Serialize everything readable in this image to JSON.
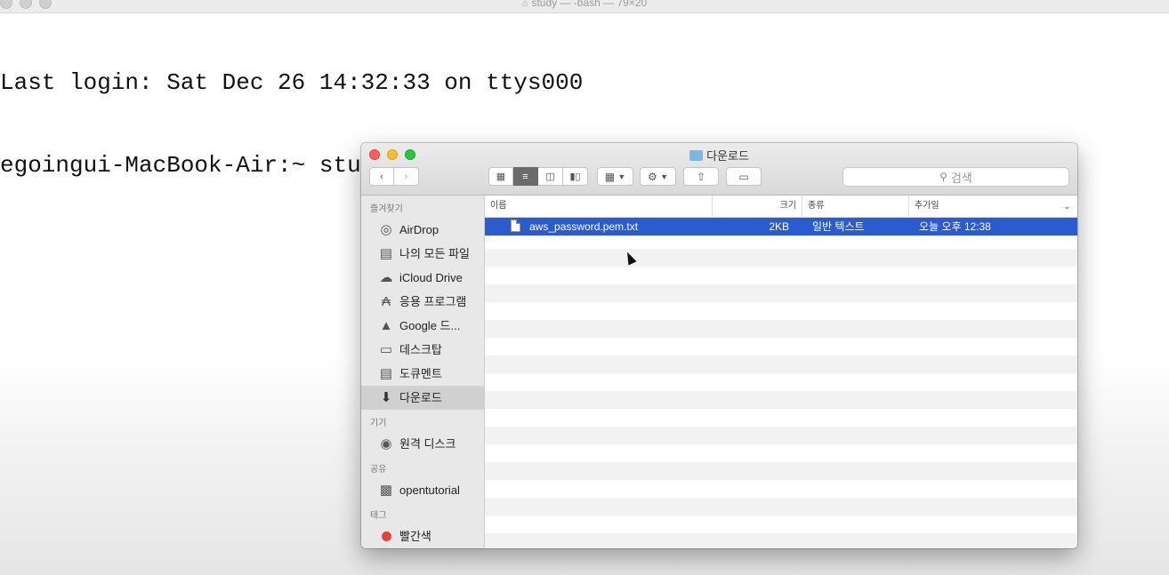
{
  "terminal": {
    "title": "study — -bash — 79×20",
    "lines": [
      "Last login: Sat Dec 26 14:32:33 on ttys000",
      "egoingui-MacBook-Air:~ study$ "
    ]
  },
  "finder": {
    "title": "다운로드",
    "search_placeholder": "검색",
    "sidebar": {
      "favorites_header": "즐겨찾기",
      "favorites": [
        {
          "label": "AirDrop",
          "icon": "airdrop-icon"
        },
        {
          "label": "나의 모든 파일",
          "icon": "all-files-icon"
        },
        {
          "label": "iCloud Drive",
          "icon": "cloud-icon"
        },
        {
          "label": "응용 프로그램",
          "icon": "applications-icon"
        },
        {
          "label": "Google 드...",
          "icon": "google-drive-icon"
        },
        {
          "label": "데스크탑",
          "icon": "desktop-icon"
        },
        {
          "label": "도큐멘트",
          "icon": "documents-icon"
        },
        {
          "label": "다운로드",
          "icon": "downloads-icon"
        }
      ],
      "devices_header": "기기",
      "devices": [
        {
          "label": "원격 디스크",
          "icon": "disc-icon"
        }
      ],
      "shared_header": "공유",
      "shared": [
        {
          "label": "opentutorial",
          "icon": "computer-icon"
        }
      ],
      "tags_header": "태그",
      "tags": [
        {
          "label": "빨간색",
          "color": "#e4433b"
        }
      ]
    },
    "columns": {
      "name": "이름",
      "size": "크기",
      "kind": "종류",
      "date_added": "추가일"
    },
    "files": [
      {
        "name": "aws_password.pem.txt",
        "size": "2KB",
        "kind": "일반 텍스트",
        "date_added": "오늘 오후 12:38"
      }
    ]
  }
}
